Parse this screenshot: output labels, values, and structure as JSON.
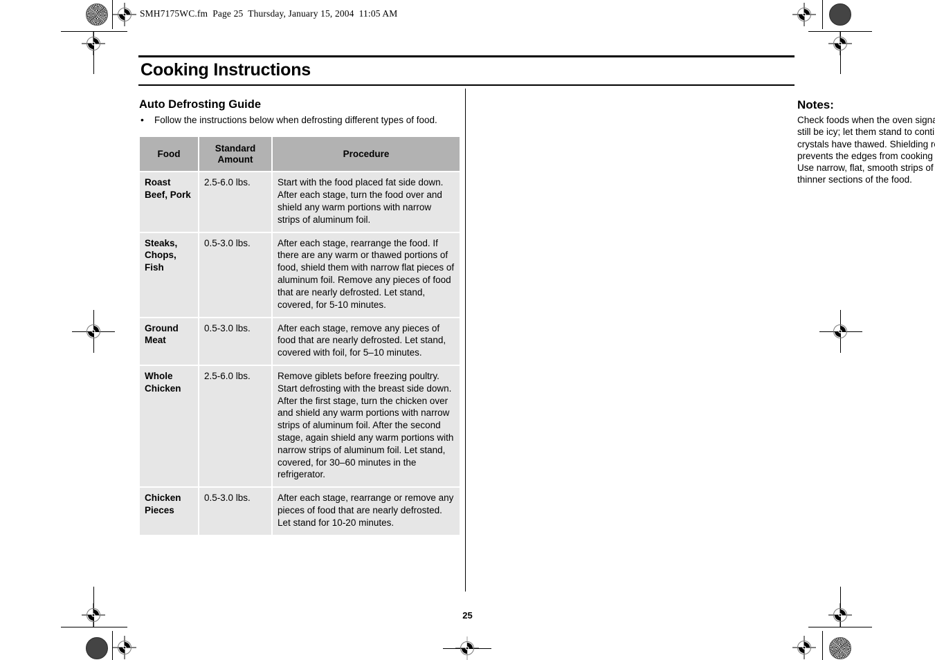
{
  "doc_header": "SMH7175WC.fm  Page 25  Thursday, January 15, 2004  11:05 AM",
  "page_title": "Cooking Instructions",
  "folio": "25",
  "colors": {
    "table_header_bg": "#b2b2b2",
    "table_cell_bg": "#e6e6e6",
    "rule": "#000000"
  },
  "left_column": {
    "heading": "Auto Defrosting Guide",
    "bullets": [
      "Follow the instructions below when defrosting different types of food."
    ],
    "table": {
      "headers": [
        "Food",
        "Standard Amount",
        "Procedure"
      ],
      "rows": [
        {
          "food": "Roast Beef, Pork",
          "amount": "2.5-6.0 lbs.",
          "procedure": "Start with the food placed fat side down. After each stage, turn the food over and shield any warm portions with narrow strips of aluminum foil."
        },
        {
          "food": "Steaks, Chops, Fish",
          "amount": "0.5-3.0 lbs.",
          "procedure": "After each stage, rearrange the food. If there are any warm or thawed portions of food, shield them with narrow flat pieces of aluminum foil. Remove any pieces of food that are nearly defrosted. Let stand, covered, for 5-10 minutes."
        },
        {
          "food": "Ground Meat",
          "amount": "0.5-3.0 lbs.",
          "procedure": "After each stage, remove any pieces of food that are nearly defrosted. Let stand, covered with foil, for 5–10 minutes."
        },
        {
          "food": "Whole Chicken",
          "amount": "2.5-6.0 lbs.",
          "procedure": "Remove giblets before freezing poultry. Start defrosting with the breast side down. After the first stage, turn the chicken over and shield any warm portions with narrow strips of aluminum foil. After the second stage, again shield any warm portions with narrow strips of aluminum foil. Let stand, covered, for 30–60 minutes in the refrigerator."
        },
        {
          "food": "Chicken Pieces",
          "amount": "0.5-3.0 lbs.",
          "procedure": "After each stage, rearrange or remove any pieces of food that are nearly defrosted. Let stand for 10-20 minutes."
        }
      ]
    }
  },
  "right_column": {
    "heading": "Notes:",
    "body": "Check foods when the oven signals. After the final stage, small sections may still be icy; let them stand to continue thawing. Do not defrost until all ice crystals have thawed. Shielding roasts and steaks with small pieces of foil prevents the edges from cooking before the center of the food has defrosted. Use narrow, flat, smooth strips of aluminum foil to cover the edges and thinner sections of the food."
  }
}
